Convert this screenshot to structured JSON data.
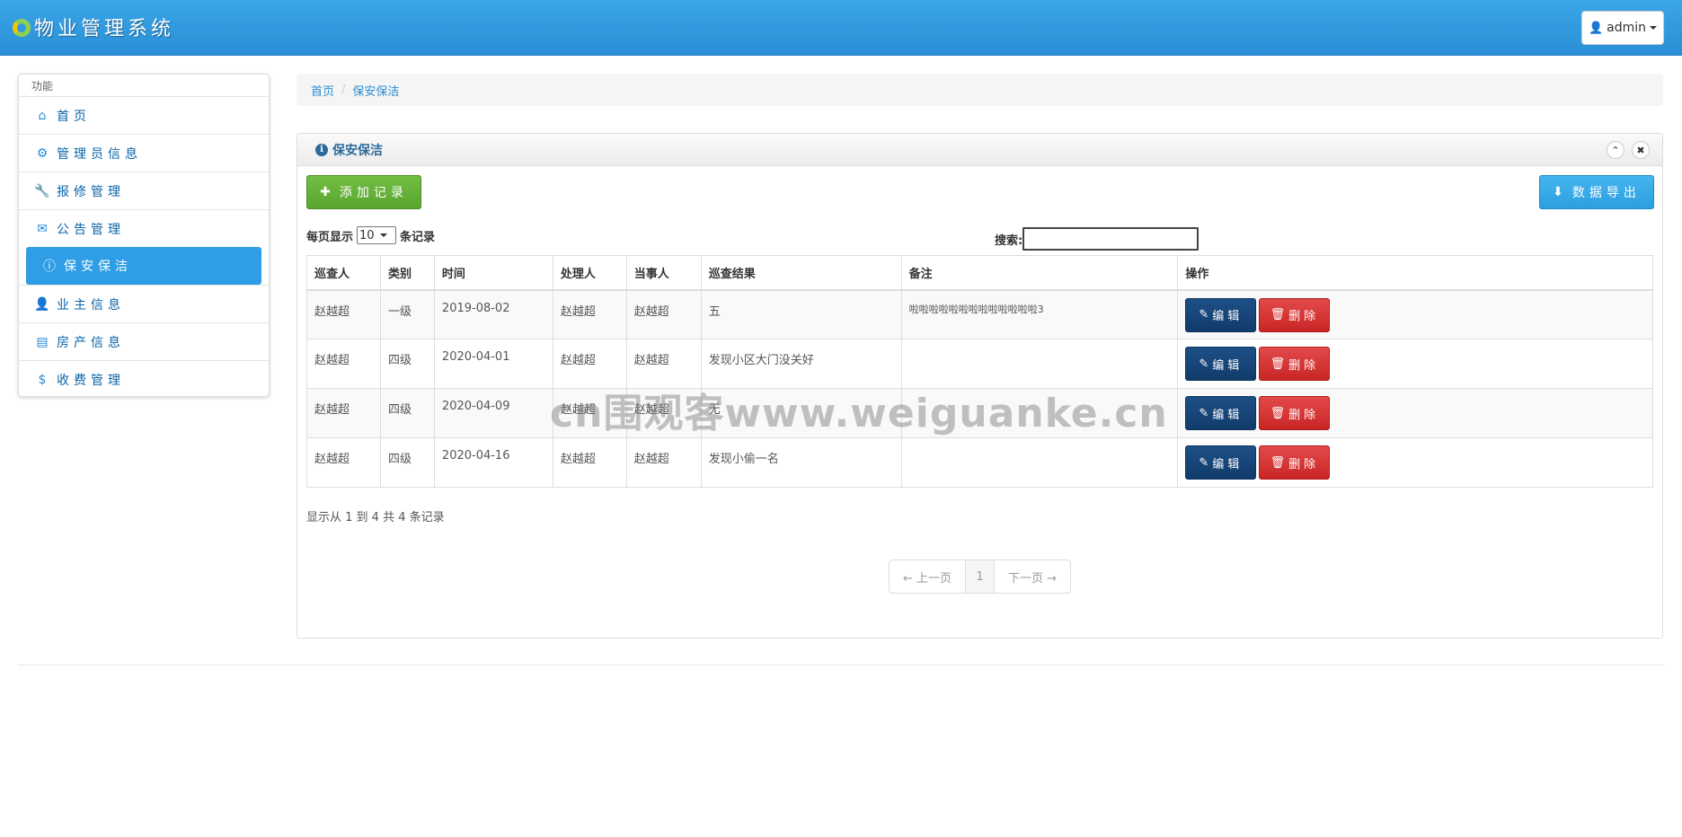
{
  "app": {
    "title": "物业管理系统"
  },
  "user": {
    "name": "admin",
    "icon": "user-icon"
  },
  "sidebar": {
    "heading": "功能",
    "items": [
      {
        "label": "首页",
        "icon": "home-icon"
      },
      {
        "label": "管理员信息",
        "icon": "gear-icon"
      },
      {
        "label": "报修管理",
        "icon": "wrench-icon"
      },
      {
        "label": "公告管理",
        "icon": "envelope-icon"
      },
      {
        "label": "保安保洁",
        "icon": "info-icon",
        "active": true
      },
      {
        "label": "业主信息",
        "icon": "user-icon"
      },
      {
        "label": "房产信息",
        "icon": "list-icon"
      },
      {
        "label": "收费管理",
        "icon": "dollar-icon"
      }
    ]
  },
  "breadcrumb": {
    "home": "首页",
    "current": "保安保洁"
  },
  "panel": {
    "title": "保安保洁",
    "add_label": "添加记录",
    "export_label": "数据导出",
    "length_prefix": "每页显示",
    "length_value": "10",
    "length_suffix": "条记录",
    "search_label": "搜索:",
    "search_value": ""
  },
  "table": {
    "columns": [
      "巡查人",
      "类别",
      "时间",
      "处理人",
      "当事人",
      "巡查结果",
      "备注",
      "操作"
    ],
    "rows": [
      {
        "inspector": "赵越超",
        "level": "一级",
        "date": "2019-08-02",
        "handler": "赵越超",
        "party": "赵越超",
        "result": "五",
        "note": "啦啦啦啦啦啦啦啦啦啦啦啦啦3"
      },
      {
        "inspector": "赵越超",
        "level": "四级",
        "date": "2020-04-01",
        "handler": "赵越超",
        "party": "赵越超",
        "result": "发现小区大门没关好",
        "note": ""
      },
      {
        "inspector": "赵越超",
        "level": "四级",
        "date": "2020-04-09",
        "handler": "赵越超",
        "party": "赵越超",
        "result": "无",
        "note": ""
      },
      {
        "inspector": "赵越超",
        "level": "四级",
        "date": "2020-04-16",
        "handler": "赵越超",
        "party": "赵越超",
        "result": "发现小偷一名",
        "note": ""
      }
    ],
    "edit_label": "编辑",
    "delete_label": "删除"
  },
  "info": "显示从 1 到 4 共 4 条记录",
  "pager": {
    "prev": "← 上一页",
    "page": "1",
    "next": "下一页 →"
  },
  "watermark": "cn围观客www.weiguanke.cn",
  "colors": {
    "navbar": "#2a8fd6",
    "active": "#2f9ee6",
    "add": "#5aa52d",
    "export": "#2d9fe0",
    "edit": "#113c6b",
    "delete": "#c92525"
  }
}
